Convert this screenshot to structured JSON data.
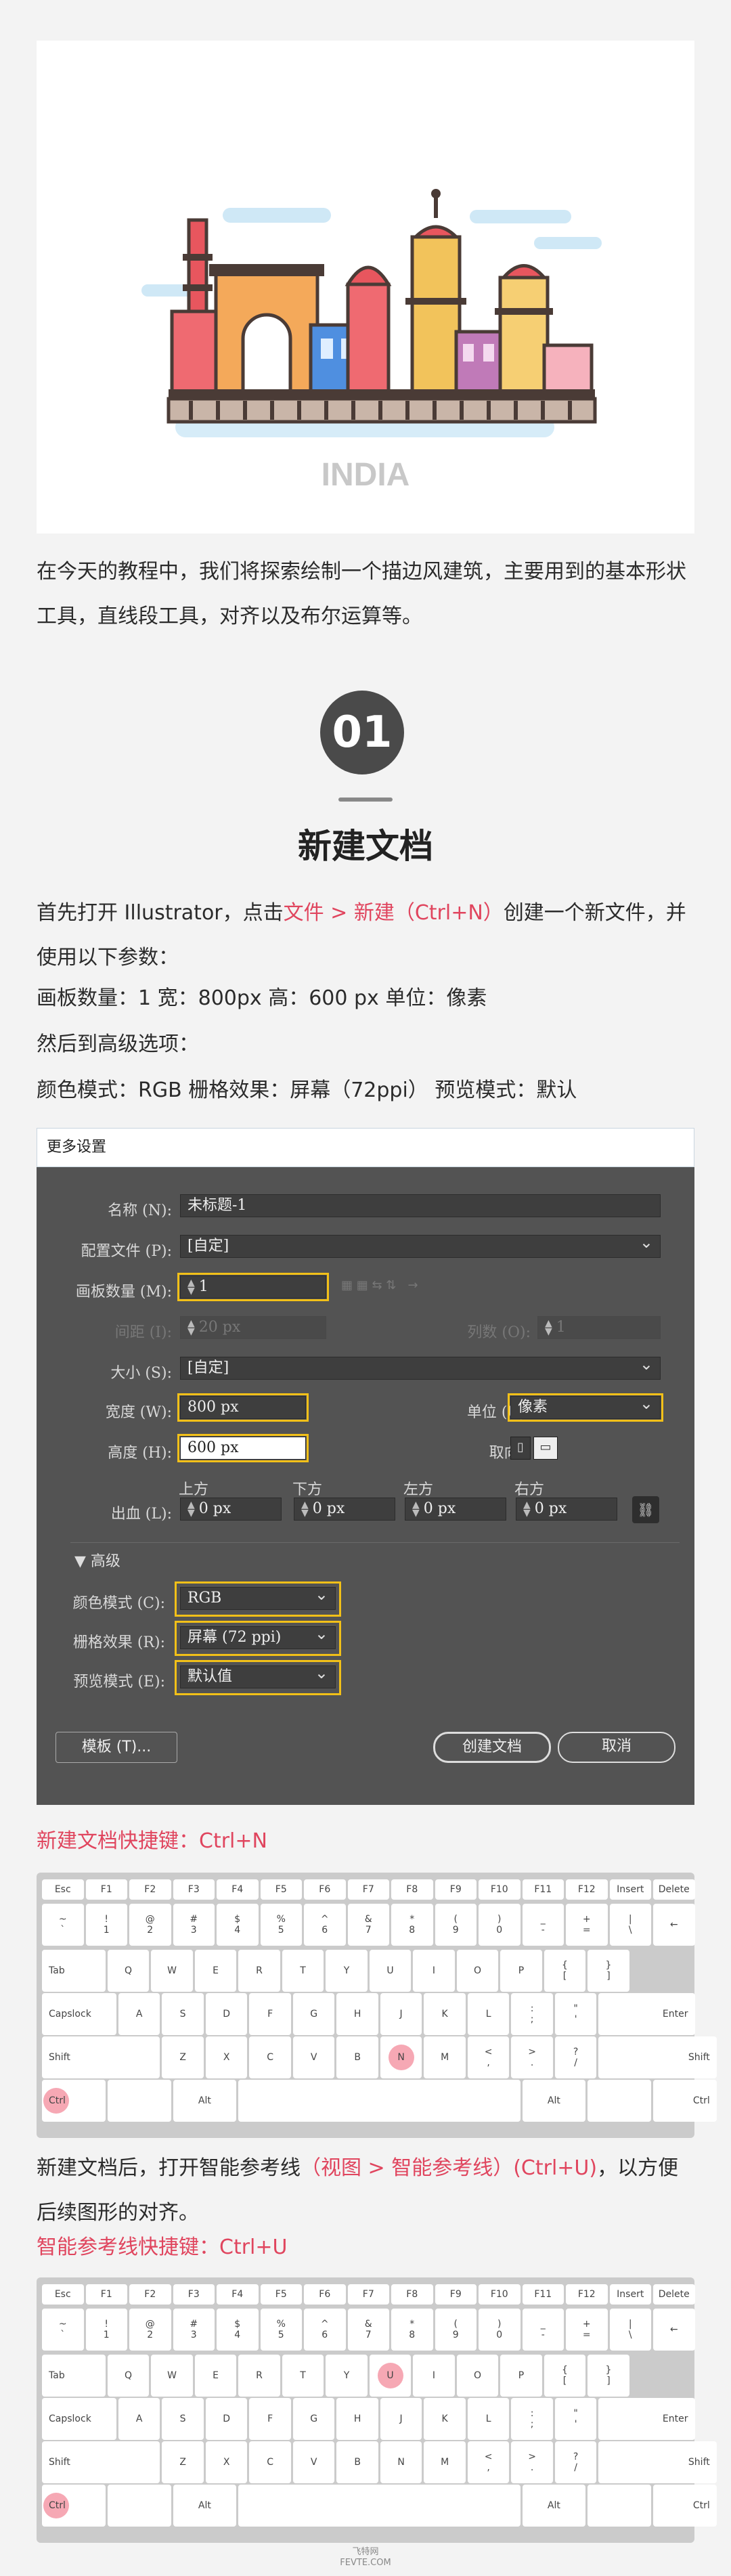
{
  "hero": {
    "caption": "INDIA"
  },
  "intro": "在今天的教程中，我们将探索绘制一个描边风建筑，主要用到的基本形状工具，直线段工具，对齐以及布尔运算等。",
  "section": {
    "number": "01",
    "title": "新建文档"
  },
  "steps": {
    "p1_pre": "首先打开 Illustrator，点击",
    "p1_link": "文件 > 新建（Ctrl+N）",
    "p1_post": "创建一个新文件，并使用以下参数：",
    "p2": "画板数量：1   宽：800px   高：600 px   单位：像素",
    "p3": "然后到高级选项：",
    "p4": "颜色模式：RGB   栅格效果：屏幕（72ppi）  预览模式：默认"
  },
  "dialog": {
    "title": "更多设置",
    "name_label": "名称 (N):",
    "name_value": "未标题-1",
    "profile_label": "配置文件 (P):",
    "profile_value": "[自定]",
    "artboards_label": "画板数量 (M):",
    "artboards_value": "1",
    "spacing_label": "间距 (I):",
    "spacing_value": "20 px",
    "columns_label": "列数 (O):",
    "columns_value": "1",
    "size_label": "大小 (S):",
    "size_value": "[自定]",
    "width_label": "宽度 (W):",
    "width_value": "800 px",
    "units_label": "单位 (U):",
    "units_value": "像素",
    "height_label": "高度 (H):",
    "height_value": "600 px",
    "orientation_label": "取向:",
    "bleed_label": "出血 (L):",
    "bleed_top_label": "上方",
    "bleed_top": "0 px",
    "bleed_bottom_label": "下方",
    "bleed_bottom": "0 px",
    "bleed_left_label": "左方",
    "bleed_left": "0 px",
    "bleed_right_label": "右方",
    "bleed_right": "0 px",
    "advanced_label": "高级",
    "color_mode_label": "颜色模式 (C):",
    "color_mode_value": "RGB",
    "raster_label": "栅格效果 (R):",
    "raster_value": "屏幕 (72 ppi)",
    "preview_label": "预览模式 (E):",
    "preview_value": "默认值",
    "templates_button": "模板 (T)...",
    "create_button": "创建文档",
    "cancel_button": "取消"
  },
  "shortcut1": "新建文档快捷键：Ctrl+N",
  "guides": {
    "pre": "新建文档后，打开智能参考线",
    "link": "（视图 > 智能参考线）(Ctrl+U)",
    "post": "，以方便后续图形的对齐。"
  },
  "shortcut2": "智能参考线快捷键：Ctrl+U",
  "keyboard": {
    "row0": [
      "Esc",
      "F1",
      "F2",
      "F3",
      "F4",
      "F5",
      "F6",
      "F7",
      "F8",
      "F9",
      "F10",
      "F11",
      "F12",
      "Insert",
      "Delete"
    ],
    "row1": [
      "~\n`",
      "!\n1",
      "@\n2",
      "#\n3",
      "$\n4",
      "%\n5",
      "^\n6",
      "&\n7",
      "*\n8",
      "(\n9",
      ")\n0",
      "_\n-",
      "+\n=",
      "|\n\\",
      "←"
    ],
    "row2": [
      "Tab",
      "Q",
      "W",
      "E",
      "R",
      "T",
      "Y",
      "U",
      "I",
      "O",
      "P",
      "{\n[",
      "}\n]"
    ],
    "row3": [
      "Capslock",
      "A",
      "S",
      "D",
      "F",
      "G",
      "H",
      "J",
      "K",
      "L",
      ":\n;",
      "\"\n'",
      "Enter"
    ],
    "row4": [
      "Shift",
      "Z",
      "X",
      "C",
      "V",
      "B",
      "N",
      "M",
      "<\n,",
      ">\n.",
      "?\n/",
      "Shift"
    ],
    "row5": [
      "Ctrl",
      "",
      "Alt",
      "",
      "Alt",
      "",
      "Ctrl"
    ]
  },
  "footer": {
    "line1": "飞特网",
    "line2": "FEVTE.COM"
  },
  "colors": {
    "accent": "#e0455e",
    "highlight": "#f2c018",
    "dialog_bg": "#535353"
  }
}
